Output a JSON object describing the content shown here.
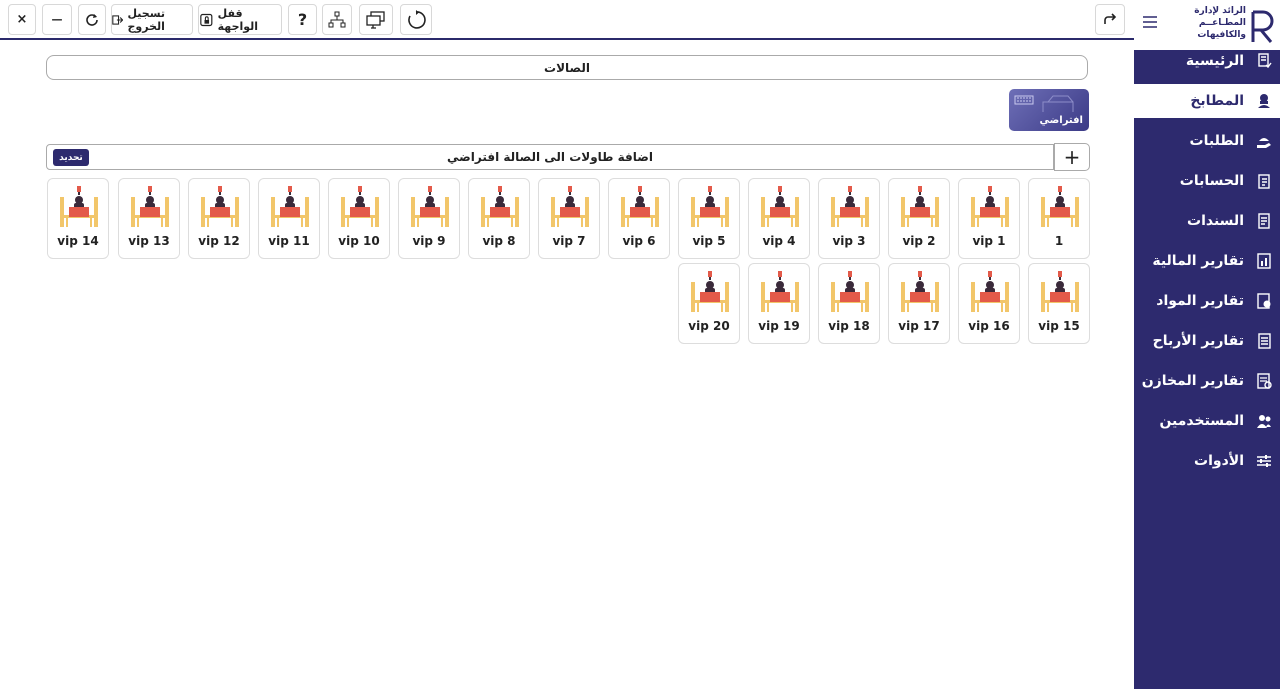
{
  "toolbar": {
    "close_glyph": "×",
    "minimize_glyph": "—",
    "logout_label": "تسجيل الخروج",
    "lock_label": "قفل الواجهة",
    "help_glyph": "?"
  },
  "app": {
    "logo_line1": "الرائد لإدارة",
    "logo_line2": "المطـاعــم",
    "logo_line3": "والكافيهات"
  },
  "sidebar": {
    "items": [
      {
        "label": "الرئيسية",
        "icon": "document-check-icon",
        "active": false
      },
      {
        "label": "المطابخ",
        "icon": "chef-icon",
        "active": true
      },
      {
        "label": "الطلبات",
        "icon": "hand-dish-icon",
        "active": false
      },
      {
        "label": "الحسابات",
        "icon": "ledger-icon",
        "active": false
      },
      {
        "label": "السندات",
        "icon": "document-list-icon",
        "active": false
      },
      {
        "label": "تقارير المالية",
        "icon": "report-finance-icon",
        "active": false
      },
      {
        "label": "تقارير المواد",
        "icon": "report-materials-icon",
        "active": false
      },
      {
        "label": "تقارير الأرباح",
        "icon": "report-profit-icon",
        "active": false
      },
      {
        "label": "تقارير المخازن",
        "icon": "report-stores-icon",
        "active": false
      },
      {
        "label": "المستخدمين",
        "icon": "users-icon",
        "active": false
      },
      {
        "label": "الأدوات",
        "icon": "sliders-icon",
        "active": false
      }
    ]
  },
  "main": {
    "halls_title": "الصالات",
    "hall_tile_label": "افتراضي",
    "add_tables_label": "اضافة طاولات الى الصالة  افتراضي",
    "refresh_label": "تحديد",
    "plus_glyph": "+",
    "tables": [
      "1",
      "vip 1",
      "vip 2",
      "vip 3",
      "vip 4",
      "vip 5",
      "vip 6",
      "vip 7",
      "vip 8",
      "vip 9",
      "vip 10",
      "vip 11",
      "vip 12",
      "vip 13",
      "vip 14",
      "vip 15",
      "vip 16",
      "vip 17",
      "vip 18",
      "vip 19",
      "vip 20"
    ]
  },
  "colors": {
    "primary": "#2d2a6e",
    "table_red": "#e35a4a",
    "chair_gold": "#f2c66a"
  }
}
